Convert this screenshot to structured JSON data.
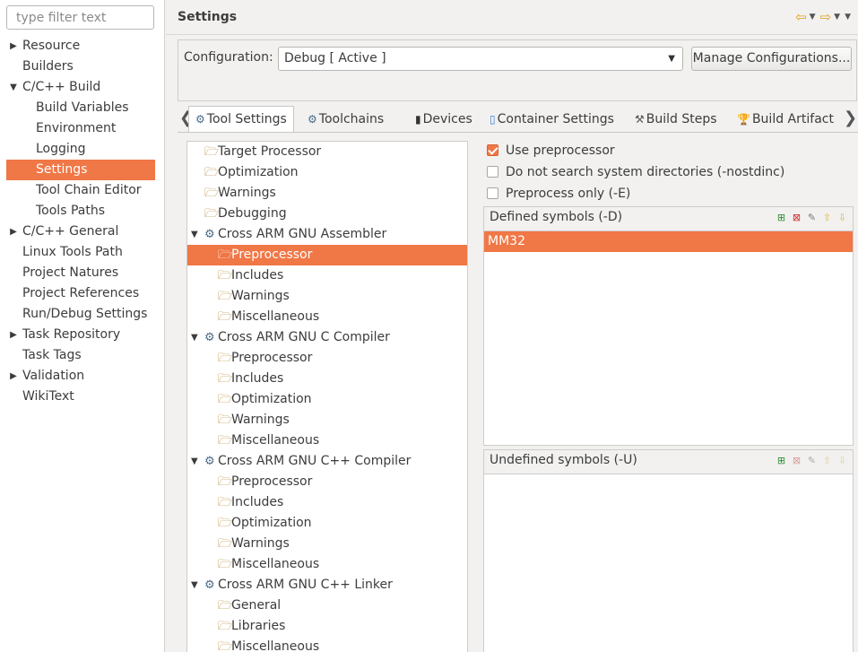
{
  "filter": {
    "placeholder": "type filter text"
  },
  "nav": [
    {
      "label": "Resource",
      "level": 0,
      "arrow": "collapsed"
    },
    {
      "label": "Builders",
      "level": 0,
      "arrow": "none"
    },
    {
      "label": "C/C++ Build",
      "level": 0,
      "arrow": "expanded"
    },
    {
      "label": "Build Variables",
      "level": 1,
      "arrow": "none"
    },
    {
      "label": "Environment",
      "level": 1,
      "arrow": "none"
    },
    {
      "label": "Logging",
      "level": 1,
      "arrow": "none"
    },
    {
      "label": "Settings",
      "level": 1,
      "arrow": "none",
      "selected": true
    },
    {
      "label": "Tool Chain Editor",
      "level": 1,
      "arrow": "none"
    },
    {
      "label": "Tools Paths",
      "level": 1,
      "arrow": "none"
    },
    {
      "label": "C/C++ General",
      "level": 0,
      "arrow": "collapsed"
    },
    {
      "label": "Linux Tools Path",
      "level": 0,
      "arrow": "none"
    },
    {
      "label": "Project Natures",
      "level": 0,
      "arrow": "none"
    },
    {
      "label": "Project References",
      "level": 0,
      "arrow": "none"
    },
    {
      "label": "Run/Debug Settings",
      "level": 0,
      "arrow": "none"
    },
    {
      "label": "Task Repository",
      "level": 0,
      "arrow": "collapsed"
    },
    {
      "label": "Task Tags",
      "level": 0,
      "arrow": "none"
    },
    {
      "label": "Validation",
      "level": 0,
      "arrow": "collapsed"
    },
    {
      "label": "WikiText",
      "level": 0,
      "arrow": "none"
    }
  ],
  "page": {
    "title": "Settings"
  },
  "config": {
    "label": "Configuration:",
    "value": "Debug  [ Active ]",
    "manage_label": "Manage Configurations..."
  },
  "tabs": [
    {
      "label": "Tool Settings",
      "icon": "tool-settings-icon",
      "active": true
    },
    {
      "label": "Toolchains",
      "icon": "toolchains-icon"
    },
    {
      "label": "Devices",
      "icon": "devices-icon"
    },
    {
      "label": "Container Settings",
      "icon": "container-icon"
    },
    {
      "label": "Build Steps",
      "icon": "build-steps-icon"
    },
    {
      "label": "Build Artifact",
      "icon": "trophy-icon"
    }
  ],
  "tree": [
    {
      "label": "Target Processor",
      "level": 1,
      "twist": "none"
    },
    {
      "label": "Optimization",
      "level": 1,
      "twist": "none"
    },
    {
      "label": "Warnings",
      "level": 1,
      "twist": "none"
    },
    {
      "label": "Debugging",
      "level": 1,
      "twist": "none"
    },
    {
      "label": "Cross ARM GNU Assembler",
      "level": 0,
      "twist": "expanded"
    },
    {
      "label": "Preprocessor",
      "level": 2,
      "twist": "none",
      "selected": true
    },
    {
      "label": "Includes",
      "level": 2,
      "twist": "none"
    },
    {
      "label": "Warnings",
      "level": 2,
      "twist": "none"
    },
    {
      "label": "Miscellaneous",
      "level": 2,
      "twist": "none"
    },
    {
      "label": "Cross ARM GNU C Compiler",
      "level": 0,
      "twist": "expanded"
    },
    {
      "label": "Preprocessor",
      "level": 2,
      "twist": "none"
    },
    {
      "label": "Includes",
      "level": 2,
      "twist": "none"
    },
    {
      "label": "Optimization",
      "level": 2,
      "twist": "none"
    },
    {
      "label": "Warnings",
      "level": 2,
      "twist": "none"
    },
    {
      "label": "Miscellaneous",
      "level": 2,
      "twist": "none"
    },
    {
      "label": "Cross ARM GNU C++ Compiler",
      "level": 0,
      "twist": "expanded"
    },
    {
      "label": "Preprocessor",
      "level": 2,
      "twist": "none"
    },
    {
      "label": "Includes",
      "level": 2,
      "twist": "none"
    },
    {
      "label": "Optimization",
      "level": 2,
      "twist": "none"
    },
    {
      "label": "Warnings",
      "level": 2,
      "twist": "none"
    },
    {
      "label": "Miscellaneous",
      "level": 2,
      "twist": "none"
    },
    {
      "label": "Cross ARM GNU C++ Linker",
      "level": 0,
      "twist": "expanded"
    },
    {
      "label": "General",
      "level": 2,
      "twist": "none"
    },
    {
      "label": "Libraries",
      "level": 2,
      "twist": "none"
    },
    {
      "label": "Miscellaneous",
      "level": 2,
      "twist": "none"
    }
  ],
  "options": {
    "use_preprocessor": {
      "label": "Use preprocessor",
      "checked": true
    },
    "nostdinc": {
      "label": "Do not search system directories (-nostdinc)",
      "checked": false
    },
    "preprocess_only": {
      "label": "Preprocess only (-E)",
      "checked": false
    }
  },
  "defined": {
    "title": "Defined symbols (-D)",
    "items": [
      "MM32"
    ]
  },
  "undefined": {
    "title": "Undefined symbols (-U)",
    "items": []
  },
  "colors": {
    "selection": "#f07746",
    "accent_arrow": "#d9a21b"
  }
}
